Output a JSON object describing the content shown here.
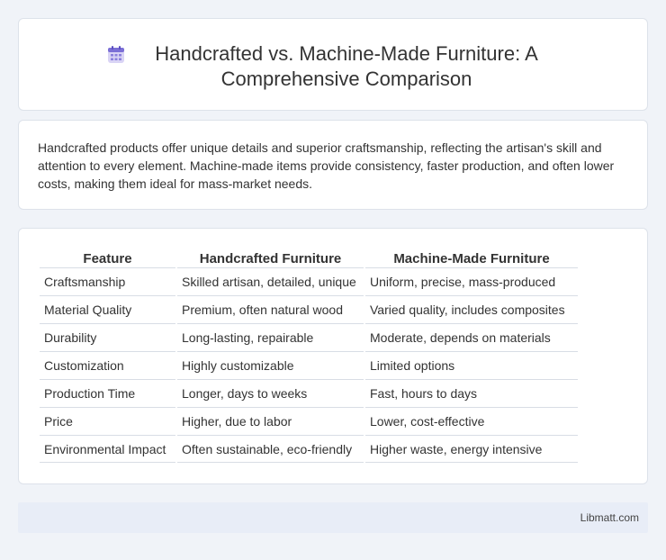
{
  "header": {
    "title": "Handcrafted vs. Machine-Made Furniture: A Comprehensive Comparison",
    "icon": "calendar-icon"
  },
  "intro": {
    "text": "Handcrafted products offer unique details and superior craftsmanship, reflecting the artisan's skill and attention to every element. Machine-made items provide consistency, faster production, and often lower costs, making them ideal for mass-market needs."
  },
  "table": {
    "headers": [
      "Feature",
      "Handcrafted Furniture",
      "Machine-Made Furniture"
    ],
    "rows": [
      [
        "Craftsmanship",
        "Skilled artisan, detailed, unique",
        "Uniform, precise, mass-produced"
      ],
      [
        "Material Quality",
        "Premium, often natural wood",
        "Varied quality, includes composites"
      ],
      [
        "Durability",
        "Long-lasting, repairable",
        "Moderate, depends on materials"
      ],
      [
        "Customization",
        "Highly customizable",
        "Limited options"
      ],
      [
        "Production Time",
        "Longer, days to weeks",
        "Fast, hours to days"
      ],
      [
        "Price",
        "Higher, due to labor",
        "Lower, cost-effective"
      ],
      [
        "Environmental Impact",
        "Often sustainable, eco-friendly",
        "Higher waste, energy intensive"
      ]
    ]
  },
  "footer": {
    "text": "Libmatt.com"
  },
  "colors": {
    "background": "#f0f3f8",
    "card": "#ffffff",
    "footer": "#e8edf7",
    "icon_top": "#7b6fd6",
    "icon_body": "#d9d4f5"
  }
}
